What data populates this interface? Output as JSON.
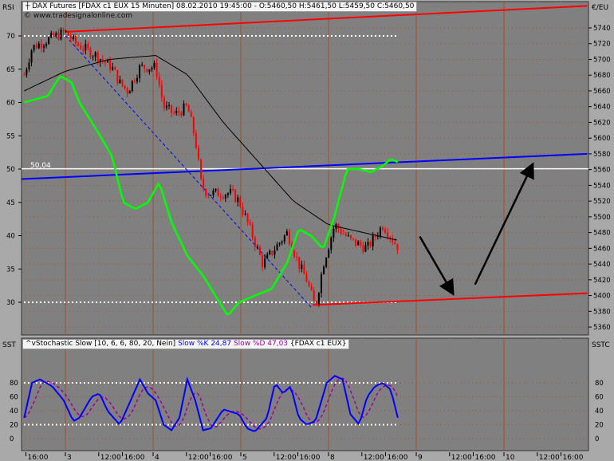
{
  "header": {
    "title": "DAX Futures [FDAX c1 EUX  15 Minuten] 08.02.2010 19:45:00 - O:5460,50 H:5461,50 L:5459,50 C:5460,50",
    "copyright": "© www.tradesignalonline.com",
    "left_label": "RSI",
    "right_label": "€/EU",
    "rsi_value_label": "50,04"
  },
  "stoch_header": {
    "prefix": "Stochastic Slow [10, 6, 6, 80, 20, Nein]",
    "k": "Slow %K 24,87",
    "d": "Slow %D 47,03",
    "suffix": "{FDAX c1 EUX}",
    "left_label": "SST",
    "right_label": "SSTC"
  },
  "colors": {
    "bg": "#808080",
    "grid": "#a0522d",
    "price_up": "#000000",
    "price_down": "#ff0000",
    "rsi": "#00ff00",
    "ma": "#000000",
    "trend_red": "#ff0000",
    "trend_blue": "#0000ff",
    "k": "#0000ff",
    "d": "#a000a0"
  },
  "chart_data": {
    "type": "line",
    "x_ticks": [
      "16:00",
      "3",
      "12:00",
      "16:00",
      "4",
      "12:00",
      "16:00",
      "5",
      "12:00",
      "16:00",
      "8",
      "12:00",
      "16:00",
      "9",
      "12:00",
      "16:00",
      "10",
      "12:00",
      "16:00"
    ],
    "x_tick_t": [
      -0.45,
      0,
      0.38,
      0.65,
      1,
      1.38,
      1.65,
      2,
      2.38,
      2.65,
      3,
      3.38,
      3.65,
      4,
      4.38,
      4.65,
      5,
      5.38,
      5.65
    ],
    "price_ticks": [
      5740,
      5720,
      5700,
      5680,
      5660,
      5640,
      5620,
      5600,
      5580,
      5560,
      5540,
      5520,
      5500,
      5480,
      5460,
      5440,
      5420,
      5400,
      5380,
      5360
    ],
    "rsi_ticks": [
      70,
      65,
      60,
      55,
      50,
      45,
      40,
      35,
      30
    ],
    "stoch_ticks": [
      80,
      60,
      40,
      20,
      0
    ],
    "price": [
      [
        -0.47,
        5680
      ],
      [
        -0.38,
        5715
      ],
      [
        -0.2,
        5725
      ],
      [
        0,
        5735
      ],
      [
        0.12,
        5720
      ],
      [
        0.35,
        5705
      ],
      [
        0.53,
        5690
      ],
      [
        0.62,
        5670
      ],
      [
        0.71,
        5660
      ],
      [
        0.85,
        5690
      ],
      [
        1.03,
        5690
      ],
      [
        1.12,
        5640
      ],
      [
        1.25,
        5630
      ],
      [
        1.39,
        5640
      ],
      [
        1.48,
        5600
      ],
      [
        1.55,
        5540
      ],
      [
        1.62,
        5530
      ],
      [
        1.89,
        5530
      ],
      [
        1.98,
        5520
      ],
      [
        2.12,
        5480
      ],
      [
        2.25,
        5440
      ],
      [
        2.39,
        5460
      ],
      [
        2.53,
        5480
      ],
      [
        2.66,
        5440
      ],
      [
        2.75,
        5420
      ],
      [
        2.85,
        5385
      ],
      [
        2.94,
        5440
      ],
      [
        3.07,
        5490
      ],
      [
        3.25,
        5470
      ],
      [
        3.44,
        5460
      ],
      [
        3.62,
        5490
      ],
      [
        3.8,
        5460
      ]
    ],
    "ma": [
      [
        -0.47,
        5660
      ],
      [
        0,
        5685
      ],
      [
        0.5,
        5700
      ],
      [
        1.03,
        5705
      ],
      [
        1.4,
        5680
      ],
      [
        1.8,
        5620
      ],
      [
        2.2,
        5570
      ],
      [
        2.6,
        5520
      ],
      [
        3.0,
        5490
      ],
      [
        3.4,
        5480
      ],
      [
        3.8,
        5470
      ]
    ],
    "rsi": [
      [
        -0.47,
        60
      ],
      [
        -0.2,
        61
      ],
      [
        -0.06,
        64
      ],
      [
        0.07,
        63
      ],
      [
        0.16,
        60
      ],
      [
        0.35,
        56
      ],
      [
        0.53,
        52
      ],
      [
        0.66,
        45
      ],
      [
        0.8,
        44
      ],
      [
        0.94,
        45
      ],
      [
        1.07,
        48
      ],
      [
        1.21,
        42
      ],
      [
        1.39,
        37
      ],
      [
        1.57,
        34
      ],
      [
        1.71,
        31
      ],
      [
        1.85,
        28
      ],
      [
        1.98,
        30
      ],
      [
        2.16,
        31
      ],
      [
        2.35,
        32
      ],
      [
        2.53,
        36
      ],
      [
        2.66,
        41
      ],
      [
        2.8,
        40
      ],
      [
        2.94,
        38
      ],
      [
        3.07,
        43
      ],
      [
        3.21,
        50
      ],
      [
        3.35,
        50
      ],
      [
        3.48,
        49.5
      ],
      [
        3.62,
        50.5
      ],
      [
        3.71,
        51.5
      ],
      [
        3.8,
        51
      ]
    ],
    "rsi_levels": [
      70,
      30
    ],
    "rsi_line_value": 50.04,
    "trend_lines": [
      {
        "color": "red",
        "from": [
          0,
          5735
        ],
        "to": [
          5.95,
          5768
        ]
      },
      {
        "color": "red",
        "from": [
          2.82,
          5388
        ],
        "to": [
          5.95,
          5403
        ]
      },
      {
        "color": "blue",
        "from": [
          -0.5,
          5548
        ],
        "to": [
          5.95,
          5580
        ]
      },
      {
        "color": "blue-dashed",
        "from": [
          0,
          5730
        ],
        "to": [
          2.82,
          5383
        ]
      }
    ],
    "arrows": [
      {
        "from": [
          4.04,
          5475
        ],
        "to": [
          4.41,
          5404
        ]
      },
      {
        "from": [
          4.67,
          5414
        ],
        "to": [
          5.32,
          5565
        ]
      }
    ],
    "stoch_k": [
      [
        -0.47,
        30
      ],
      [
        -0.38,
        80
      ],
      [
        -0.29,
        85
      ],
      [
        -0.15,
        75
      ],
      [
        -0.02,
        55
      ],
      [
        0.09,
        25
      ],
      [
        0.16,
        30
      ],
      [
        0.3,
        60
      ],
      [
        0.39,
        65
      ],
      [
        0.48,
        40
      ],
      [
        0.62,
        20
      ],
      [
        0.71,
        45
      ],
      [
        0.85,
        85
      ],
      [
        0.94,
        65
      ],
      [
        1.03,
        55
      ],
      [
        1.12,
        20
      ],
      [
        1.21,
        12
      ],
      [
        1.3,
        30
      ],
      [
        1.39,
        85
      ],
      [
        1.48,
        55
      ],
      [
        1.57,
        12
      ],
      [
        1.66,
        15
      ],
      [
        1.8,
        42
      ],
      [
        1.98,
        35
      ],
      [
        2.07,
        15
      ],
      [
        2.16,
        10
      ],
      [
        2.3,
        30
      ],
      [
        2.39,
        80
      ],
      [
        2.48,
        65
      ],
      [
        2.57,
        75
      ],
      [
        2.66,
        30
      ],
      [
        2.75,
        20
      ],
      [
        2.85,
        25
      ],
      [
        2.98,
        80
      ],
      [
        3.07,
        90
      ],
      [
        3.16,
        85
      ],
      [
        3.25,
        35
      ],
      [
        3.35,
        20
      ],
      [
        3.44,
        60
      ],
      [
        3.53,
        75
      ],
      [
        3.62,
        80
      ],
      [
        3.71,
        70
      ],
      [
        3.8,
        25
      ]
    ],
    "stoch_levels": [
      80,
      20
    ]
  }
}
